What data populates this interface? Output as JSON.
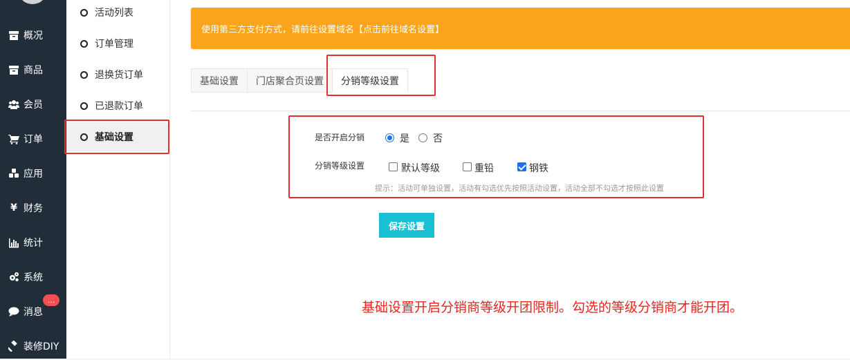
{
  "sidebar": {
    "items": [
      {
        "label": "概况",
        "icon": "archive-icon"
      },
      {
        "label": "商品",
        "icon": "archive-icon"
      },
      {
        "label": "会员",
        "icon": "users-icon"
      },
      {
        "label": "订单",
        "icon": "cart-icon"
      },
      {
        "label": "应用",
        "icon": "cubes-icon"
      },
      {
        "label": "财务",
        "icon": "yen-icon"
      },
      {
        "label": "统计",
        "icon": "bar-chart-icon"
      },
      {
        "label": "系统",
        "icon": "gears-icon"
      },
      {
        "label": "消息",
        "icon": "comment-icon"
      },
      {
        "label": "装修DIY",
        "icon": "gavel-icon"
      }
    ],
    "message_badge": "..."
  },
  "subnav": {
    "items": [
      {
        "label": "活动列表"
      },
      {
        "label": "订单管理"
      },
      {
        "label": "退换货订单"
      },
      {
        "label": "已退款订单"
      },
      {
        "label": "基础设置",
        "active": true
      }
    ]
  },
  "alert": {
    "text": "使用第三方支付方式，请前往设置域名【点击前往域名设置】",
    "color": "#fba41c"
  },
  "tabs": [
    {
      "label": "基础设置"
    },
    {
      "label": "门店聚合页设置"
    },
    {
      "label": "分销等级设置",
      "active": true
    }
  ],
  "form": {
    "enable_label": "是否开启分销",
    "enable_options": [
      {
        "label": "是",
        "checked": true
      },
      {
        "label": "否",
        "checked": false
      }
    ],
    "level_label": "分销等级设置",
    "level_options": [
      {
        "label": "默认等级",
        "checked": false
      },
      {
        "label": "重铅",
        "checked": false
      },
      {
        "label": "钢铁",
        "checked": true
      }
    ],
    "hint": "提示：活动可单独设置，活动有勾选优先按照活动设置，活动全部不勾选才按照此设置"
  },
  "save_button": {
    "label": "保存设置",
    "color": "#19c0d3"
  },
  "annotation": {
    "text": "基础设置开启分销商等级开团限制。勾选的等级分销商才能开团。",
    "color": "#e6261f"
  },
  "highlight_color": "#e62e2e"
}
